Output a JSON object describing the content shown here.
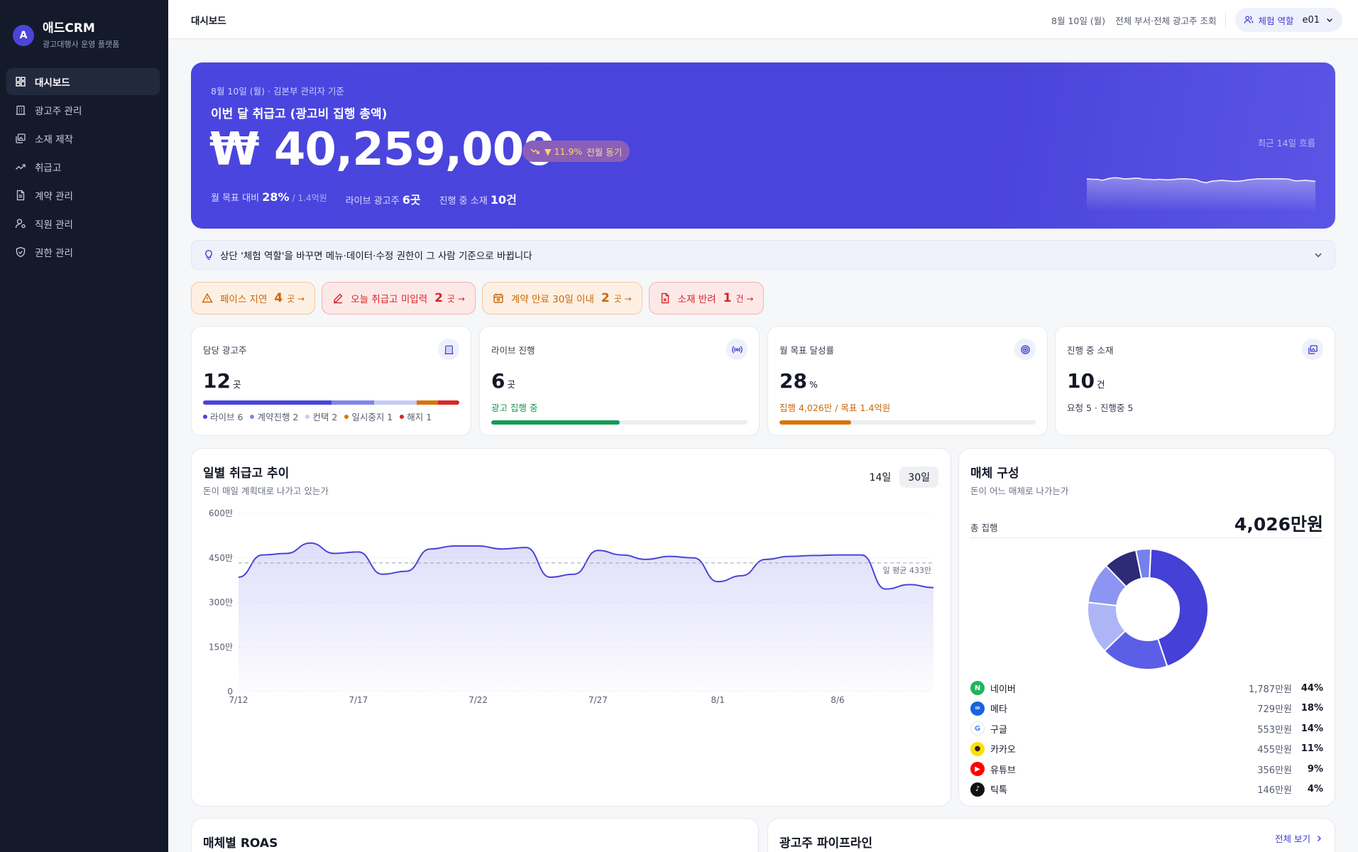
{
  "app": {
    "logo_letter": "A",
    "name": "애드CRM",
    "subtitle": "광고대행사 운영 플랫폼"
  },
  "nav": [
    {
      "label": "대시보드",
      "icon": "dashboard-icon",
      "active": true
    },
    {
      "label": "광고주 관리",
      "icon": "building-icon"
    },
    {
      "label": "소재 제작",
      "icon": "images-icon"
    },
    {
      "label": "취급고",
      "icon": "trending-icon"
    },
    {
      "label": "계약 관리",
      "icon": "document-icon"
    },
    {
      "label": "직원 관리",
      "icon": "user-gear-icon"
    },
    {
      "label": "권한 관리",
      "icon": "shield-icon"
    }
  ],
  "topbar": {
    "title": "대시보드",
    "date": "8월 10일 (월)",
    "scope": "전체 부서·전체 광고주 조회",
    "role_label": "체험 역할",
    "role_value": "e01"
  },
  "hero": {
    "date_line": "8월 10일 (월) · 김본부 관리자 기준",
    "title": "이번 달 취급고 (광고비 집행 총액)",
    "amount": "₩ 40,259,000",
    "change": "▼ 11.9%",
    "change_label": "전월 동기",
    "stats": [
      {
        "label": "월 목표 대비",
        "value": "28%",
        "extra": "/ 1.4억원"
      },
      {
        "label": "라이브 광고주",
        "value": "6곳",
        "extra": ""
      },
      {
        "label": "진행 중 소재",
        "value": "10건",
        "extra": ""
      }
    ],
    "spark_label": "최근 14일 흐름",
    "spark_values": [
      66,
      65,
      65,
      63,
      66,
      68,
      68,
      66,
      66,
      67,
      67,
      65,
      65,
      64,
      65,
      64,
      64,
      65,
      66,
      66,
      65,
      64,
      60,
      58,
      61,
      62,
      63,
      62,
      61,
      61,
      62,
      64,
      65,
      66,
      66,
      66,
      66,
      66,
      66,
      65,
      62,
      62,
      63,
      62,
      61
    ]
  },
  "notice": {
    "text": "상단 '체험 역할'을 바꾸면 메뉴·데이터·수정 권한이 그 사람 기준으로 바뀝니다"
  },
  "alerts": [
    {
      "label": "페이스 지연",
      "count": "4",
      "unit": "곳 →",
      "tone": "orange",
      "icon": "warning-icon"
    },
    {
      "label": "오늘 취급고 미입력",
      "count": "2",
      "unit": "곳 →",
      "tone": "red",
      "icon": "pencil-icon"
    },
    {
      "label": "계약 만료 30일 이내",
      "count": "2",
      "unit": "곳 →",
      "tone": "orange",
      "icon": "calendar-icon"
    },
    {
      "label": "소재 반려",
      "count": "1",
      "unit": "건 →",
      "tone": "red",
      "icon": "file-reject-icon"
    }
  ],
  "kpis": {
    "advertisers": {
      "label": "담당 광고주",
      "value": "12",
      "unit": "곳",
      "segments": [
        {
          "label": "라이브 6",
          "count": 6,
          "color": "#4a45d8"
        },
        {
          "label": "계약진행 2",
          "count": 2,
          "color": "#7f86ea"
        },
        {
          "label": "컨택 2",
          "count": 2,
          "color": "#c6cbf5"
        },
        {
          "label": "일시중지 1",
          "count": 1,
          "color": "#d9740a"
        },
        {
          "label": "해지 1",
          "count": 1,
          "color": "#d62828"
        }
      ]
    },
    "live": {
      "label": "라이브 진행",
      "value": "6",
      "unit": "곳",
      "sub": "광고 집행 중",
      "progress": 0.5,
      "color": "#159a55"
    },
    "goal": {
      "label": "월 목표 달성률",
      "value": "28",
      "unit": "%",
      "sub": "집행 4,026만 / 목표 1.4억원",
      "progress": 0.28,
      "color": "#d9740a"
    },
    "creatives": {
      "label": "진행 중 소재",
      "value": "10",
      "unit": "건",
      "sub": "요청 5 · 진행중 5"
    }
  },
  "trend": {
    "title": "일별 취급고 추이",
    "subtitle": "돈이 매일 계획대로 나가고 있는가",
    "range_options": [
      "14일",
      "30일"
    ],
    "selected_range": "30일",
    "avg_label": "일 평균 433만"
  },
  "chart_data": {
    "type": "area",
    "x": [
      "7/12",
      "7/13",
      "7/14",
      "7/15",
      "7/16",
      "7/17",
      "7/18",
      "7/19",
      "7/20",
      "7/21",
      "7/22",
      "7/23",
      "7/24",
      "7/25",
      "7/26",
      "7/27",
      "7/28",
      "7/29",
      "7/30",
      "7/31",
      "8/1",
      "8/2",
      "8/3",
      "8/4",
      "8/5",
      "8/6",
      "8/7",
      "8/8",
      "8/9",
      "8/10"
    ],
    "x_ticks": [
      "7/12",
      "7/17",
      "7/22",
      "7/27",
      "8/1",
      "8/6"
    ],
    "series": [
      {
        "values": [
          385,
          460,
          465,
          500,
          465,
          470,
          395,
          405,
          480,
          490,
          490,
          480,
          485,
          385,
          395,
          475,
          460,
          445,
          455,
          450,
          370,
          390,
          445,
          455,
          458,
          460,
          460,
          345,
          360,
          350
        ]
      }
    ],
    "y_ticks": [
      0,
      150,
      300,
      450,
      600
    ],
    "y_tick_labels": [
      "0",
      "150만",
      "300만",
      "450만",
      "600만"
    ],
    "ylim": [
      0,
      600
    ],
    "average": 433,
    "grid": true
  },
  "media": {
    "title": "매체 구성",
    "subtitle": "돈이 어느 매체로 나가는가",
    "total_label": "총 집행",
    "total": "4,026만원",
    "items": [
      {
        "name": "네이버",
        "amount": "1,787만원",
        "pct": "44%",
        "value": 44,
        "icon": "naver-icon",
        "badge": "N",
        "badge_color": "#1fb55a",
        "slice_color": "#4540d6"
      },
      {
        "name": "메타",
        "amount": "729만원",
        "pct": "18%",
        "value": 18,
        "icon": "meta-icon",
        "badge": "∞",
        "badge_color": "#1763e0",
        "slice_color": "#5b5ee6"
      },
      {
        "name": "구글",
        "amount": "553만원",
        "pct": "14%",
        "value": 14,
        "icon": "google-icon",
        "badge": "G",
        "badge_color": "#ffffff",
        "slice_color": "#adb5f6"
      },
      {
        "name": "카카오",
        "amount": "455만원",
        "pct": "11%",
        "value": 11,
        "icon": "kakao-icon",
        "badge": "●",
        "badge_color": "#fae100",
        "slice_color": "#8c95f2"
      },
      {
        "name": "유튜브",
        "amount": "356만원",
        "pct": "9%",
        "value": 9,
        "icon": "youtube-icon",
        "badge": "▶",
        "badge_color": "#ff0000",
        "slice_color": "#2d2a78"
      },
      {
        "name": "틱톡",
        "amount": "146만원",
        "pct": "4%",
        "value": 4,
        "icon": "tiktok-icon",
        "badge": "♪",
        "badge_color": "#111111",
        "slice_color": "#7781ec"
      }
    ]
  },
  "roas": {
    "title": "매체별 ROAS"
  },
  "pipeline": {
    "title": "광고주 파이프라인",
    "view_all": "전체 보기"
  }
}
